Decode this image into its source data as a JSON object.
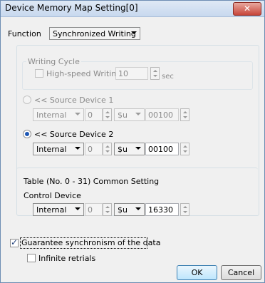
{
  "window": {
    "title": "Device Memory Map Setting[0]",
    "close_glyph": "✕"
  },
  "function": {
    "label": "Function",
    "value": "Synchronized Writing"
  },
  "writing_cycle": {
    "label": "Writing Cycle",
    "highspeed_label": "High-speed Writing",
    "value": "10",
    "unit": "sec"
  },
  "source1": {
    "label": "<< Source Device 1",
    "device": "Internal",
    "num": "0",
    "type": "$u",
    "addr": "00100"
  },
  "source2": {
    "label": "<< Source Device 2",
    "device": "Internal",
    "num": "0",
    "type": "$u",
    "addr": "00100"
  },
  "table": {
    "label": "Table (No. 0 - 31) Common Setting",
    "control_label": "Control Device",
    "device": "Internal",
    "num": "0",
    "type": "$u",
    "addr": "16330"
  },
  "options": {
    "guarantee_label": "Guarantee synchronism of the data",
    "guarantee_checked": true,
    "infinite_label": "Infinite retrials",
    "infinite_checked": false
  },
  "buttons": {
    "ok": "OK",
    "cancel": "Cancel"
  }
}
